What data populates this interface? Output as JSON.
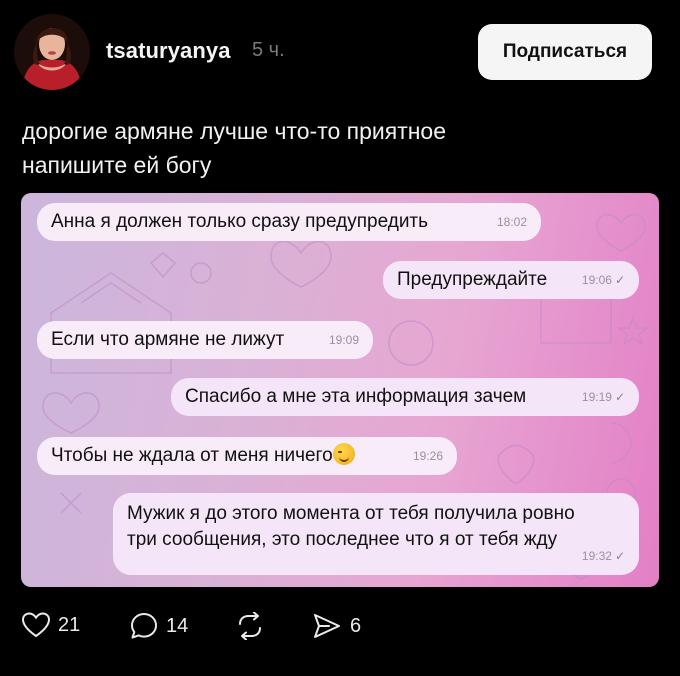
{
  "post": {
    "username": "tsaturyanya",
    "time": "5 ч.",
    "follow_label": "Подписаться",
    "text_lines": [
      "дорогие армяне лучше что-то приятное",
      "напишите ей богу"
    ]
  },
  "chat": {
    "messages": [
      {
        "text": "Анна я должен только сразу предупредить",
        "time": "18:02",
        "direction": "in"
      },
      {
        "text": "Предупреждайте",
        "time": "19:06",
        "direction": "out",
        "read": true
      },
      {
        "text": "Если что армяне не лижут",
        "time": "19:09",
        "direction": "in"
      },
      {
        "text": "Спасибо а мне эта информация зачем",
        "time": "19:19",
        "direction": "out",
        "read": true
      },
      {
        "text": "Чтобы не ждала от меня ничего",
        "time": "19:26",
        "direction": "in",
        "emoji": "wink-face"
      },
      {
        "text_lines": [
          "Мужик я до этого момента от тебя получила ровно",
          "три сообщения, это последнее что я от тебя жду"
        ],
        "time": "19:32",
        "direction": "out",
        "read": true
      }
    ],
    "read_mark": "✓"
  },
  "actions": {
    "likes": "21",
    "comments": "14",
    "shares": "6"
  },
  "colors": {
    "background": "#000000",
    "follow_button_bg": "#f5f5f5",
    "chat_gradient_start": "#cbb6dc",
    "chat_gradient_end": "#e37fc6",
    "bubble_bg": "#f7ecf8"
  },
  "icons": {
    "like": "heart-icon",
    "comment": "comment-bubble-icon",
    "repost": "repost-icon",
    "share": "send-icon"
  }
}
